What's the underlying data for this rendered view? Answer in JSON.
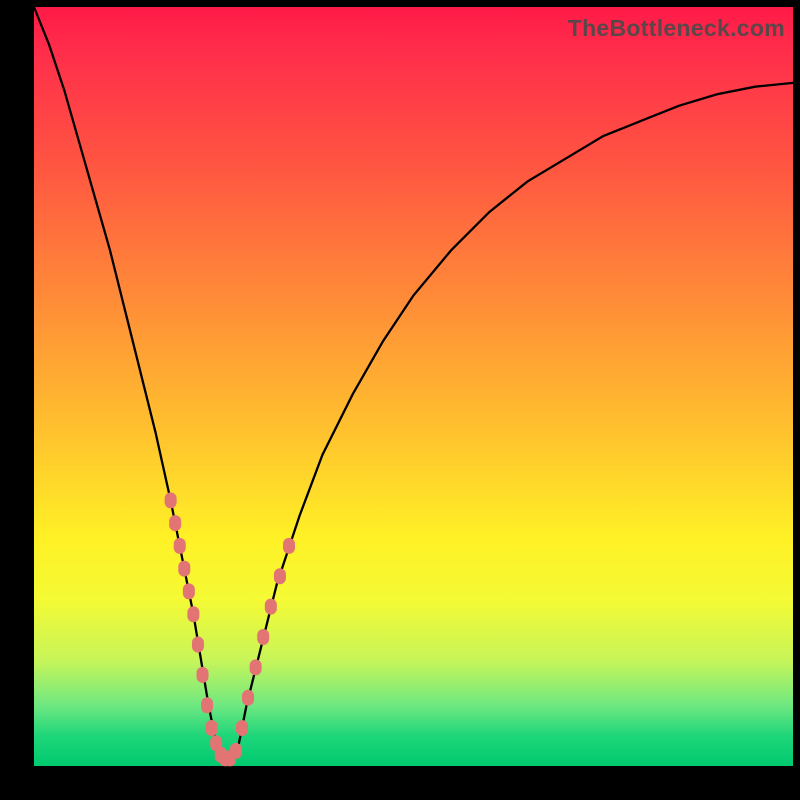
{
  "watermark": "TheBottleneck.com",
  "chart_data": {
    "type": "line",
    "title": "",
    "xlabel": "",
    "ylabel": "",
    "xlim": [
      0,
      100
    ],
    "ylim": [
      0,
      100
    ],
    "grid": false,
    "legend": false,
    "series": [
      {
        "name": "bottleneck-curve",
        "x": [
          0,
          2,
          4,
          6,
          8,
          10,
          12,
          14,
          16,
          18,
          20,
          21,
          22,
          23,
          24,
          25,
          26,
          27,
          28,
          30,
          32,
          35,
          38,
          42,
          46,
          50,
          55,
          60,
          65,
          70,
          75,
          80,
          85,
          90,
          95,
          100
        ],
        "y": [
          100,
          95,
          89,
          82,
          75,
          68,
          60,
          52,
          44,
          35,
          25,
          20,
          14,
          8,
          3,
          1,
          1,
          3,
          8,
          16,
          24,
          33,
          41,
          49,
          56,
          62,
          68,
          73,
          77,
          80,
          83,
          85,
          87,
          88.5,
          89.5,
          90
        ]
      }
    ],
    "markers": {
      "name": "highlight-points",
      "shape": "rounded",
      "color": "#e27474",
      "x": [
        18.0,
        18.6,
        19.2,
        19.8,
        20.4,
        21.0,
        21.6,
        22.2,
        22.8,
        23.4,
        24.0,
        24.6,
        25.2,
        25.8,
        26.6,
        27.4,
        28.2,
        29.2,
        30.2,
        31.2,
        32.4,
        33.6
      ],
      "y": [
        35,
        32,
        29,
        26,
        23,
        20,
        16,
        12,
        8,
        5,
        3,
        1.5,
        1,
        1,
        2,
        5,
        9,
        13,
        17,
        21,
        25,
        29
      ]
    },
    "background_gradient": {
      "top": "#ff1a47",
      "mid_upper": "#ff8a38",
      "mid": "#fff126",
      "mid_lower": "#c8f558",
      "bottom": "#00c96f"
    }
  }
}
